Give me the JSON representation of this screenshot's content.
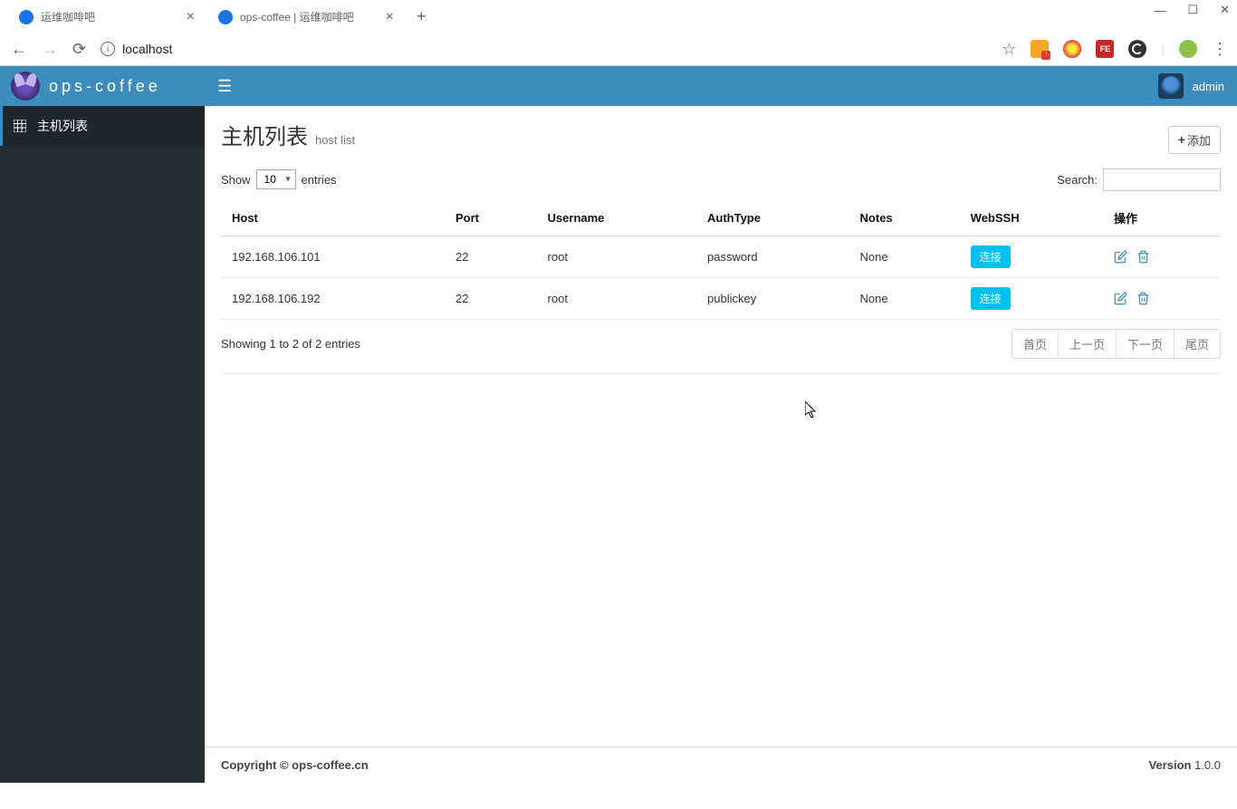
{
  "browser": {
    "tabs": [
      {
        "title": "运维咖啡吧"
      },
      {
        "title": "ops-coffee | 运维咖啡吧"
      }
    ],
    "url": "localhost",
    "window_controls": {
      "minimize": "—",
      "maximize": "☐",
      "close": "✕"
    }
  },
  "app": {
    "brand": "ops-coffee",
    "user": "admin"
  },
  "sidebar": {
    "items": [
      {
        "label": "主机列表"
      }
    ]
  },
  "page": {
    "title": "主机列表",
    "subtitle": "host list",
    "add_label": "添加"
  },
  "table": {
    "show_label": "Show",
    "entries_label": "entries",
    "entries_value": "10",
    "search_label": "Search:",
    "columns": [
      "Host",
      "Port",
      "Username",
      "AuthType",
      "Notes",
      "WebSSH",
      "操作"
    ],
    "rows": [
      {
        "host": "192.168.106.101",
        "port": "22",
        "username": "root",
        "authtype": "password",
        "notes": "None",
        "connect": "连接"
      },
      {
        "host": "192.168.106.192",
        "port": "22",
        "username": "root",
        "authtype": "publickey",
        "notes": "None",
        "connect": "连接"
      }
    ],
    "info": "Showing 1 to 2 of 2 entries",
    "pagination": {
      "first": "首页",
      "prev": "上一页",
      "next": "下一页",
      "last": "尾页"
    }
  },
  "footer": {
    "copyright": "Copyright © ops-coffee.cn",
    "version_label": "Version",
    "version": "1.0.0"
  }
}
